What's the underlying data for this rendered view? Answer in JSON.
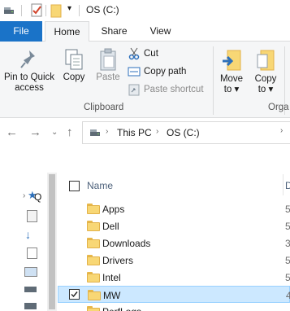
{
  "window": {
    "title": "OS (C:)"
  },
  "ribbon_tabs": [
    {
      "label": "File"
    },
    {
      "label": "Home"
    },
    {
      "label": "Share"
    },
    {
      "label": "View"
    }
  ],
  "clipboard": {
    "pin_label_1": "Pin to Quick",
    "pin_label_2": "access",
    "copy_label": "Copy",
    "paste_label": "Paste",
    "cut_label": "Cut",
    "copy_path_label": "Copy path",
    "paste_shortcut_label": "Paste shortcut",
    "group_label": "Clipboard"
  },
  "organize": {
    "move_to_1": "Move",
    "move_to_2": "to",
    "copy_to_1": "Copy",
    "copy_to_2": "to",
    "group_label_partial": "Orga"
  },
  "address": {
    "crumbs": [
      "This PC",
      "OS (C:)"
    ]
  },
  "file_list": {
    "header_name": "Name",
    "header_date_partial": "D",
    "rows": [
      {
        "name": "Apps",
        "date_partial": "5",
        "selected": false
      },
      {
        "name": "Dell",
        "date_partial": "5",
        "selected": false
      },
      {
        "name": "Downloads",
        "date_partial": "3",
        "selected": false
      },
      {
        "name": "Drivers",
        "date_partial": "5",
        "selected": false
      },
      {
        "name": "Intel",
        "date_partial": "5",
        "selected": false
      },
      {
        "name": "MW",
        "date_partial": "4",
        "selected": true
      },
      {
        "name": "PerfLogs",
        "date_partial": "",
        "selected": false
      }
    ]
  },
  "navpane": {
    "quick_access_partial": "Q"
  },
  "colors": {
    "accent": "#1a73c8",
    "selection": "#cce8ff",
    "folder": "#f8d775"
  }
}
